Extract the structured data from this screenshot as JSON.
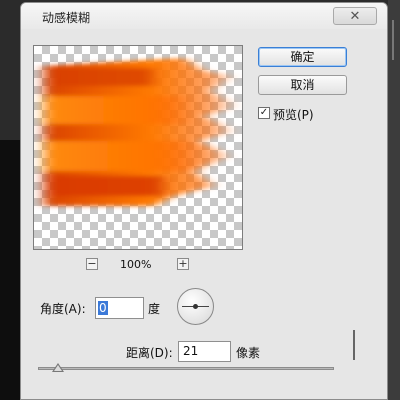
{
  "dialog": {
    "title": "动感模糊",
    "close_glyph": "✕"
  },
  "buttons": {
    "ok_label": "确定",
    "cancel_label": "取消"
  },
  "preview_option": {
    "label": "预览(P)",
    "checked": true,
    "check_glyph": "✓"
  },
  "zoom": {
    "out_glyph": "−",
    "in_glyph": "+",
    "level": "100%"
  },
  "angle": {
    "label": "角度(A):",
    "value": "0",
    "unit": "度"
  },
  "distance": {
    "label": "距离(D):",
    "value": "21",
    "unit": "像素"
  },
  "slider": {
    "value": 21
  },
  "colors": {
    "accent": "#3b79d8",
    "flame_orange": "#ff7a00",
    "flame_red": "#d93a00"
  }
}
